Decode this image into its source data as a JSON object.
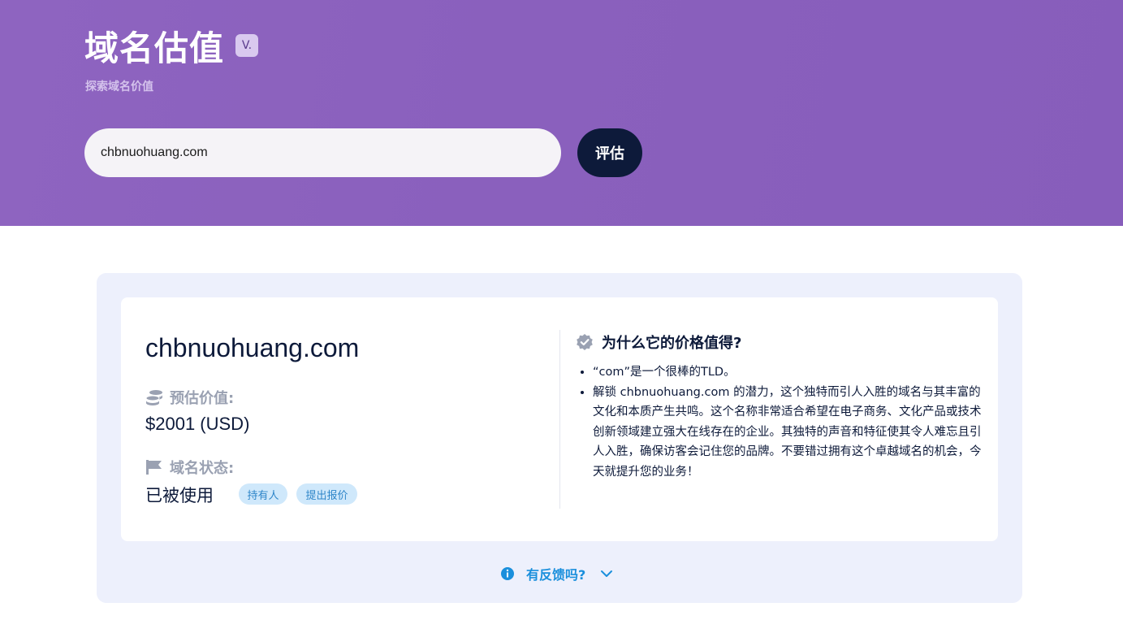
{
  "header": {
    "title": "域名估值",
    "badge": "V.",
    "subtitle": "探索域名价值"
  },
  "search": {
    "value": "chbnuohuang.com",
    "button_label": "评估"
  },
  "result": {
    "domain": "chbnuohuang.com",
    "estimate_label": "预估价值:",
    "estimate_value": "$2001 (USD)",
    "status_label": "域名状态:",
    "status_value": "已被使用",
    "owner_pill": "持有人",
    "offer_pill": "提出报价"
  },
  "why": {
    "title": "为什么它的价格值得?",
    "points": [
      "“com”是一个很棒的TLD。",
      "解锁 chbnuohuang.com 的潜力，这个独特而引人入胜的域名与其丰富的文化和本质产生共鸣。这个名称非常适合希望在电子商务、文化产品或技术创新领域建立强大在线存在的企业。其独特的声音和特征使其令人难忘且引人入胜，确保访客会记住您的品牌。不要错过拥有这个卓越域名的机会，今天就提升您的业务！"
    ]
  },
  "feedback": {
    "label": "有反馈吗?"
  },
  "colors": {
    "hero": "#8a60bd",
    "navy": "#0d1a3a",
    "pill_bg": "#cfe8fb",
    "link_blue": "#1a8fdc"
  },
  "icons": [
    "coins-icon",
    "flag-icon",
    "verified-badge-icon",
    "info-icon",
    "chevron-down-icon"
  ]
}
